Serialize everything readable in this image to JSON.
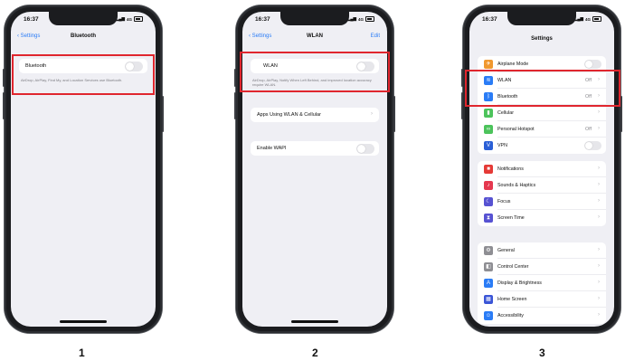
{
  "status": {
    "time": "16:37",
    "signal": "4G"
  },
  "phone1": {
    "back": "Settings",
    "title": "Bluetooth",
    "row_label": "Bluetooth",
    "note": "AirDrop, AirPlay, Find My, and Location Services use Bluetooth.",
    "number": "1"
  },
  "phone2": {
    "back": "Settings",
    "title": "WLAN",
    "edit": "Edit",
    "wlan_label": "WLAN",
    "note": "AirDrop, AirPlay, Notify When Left Behind, and improved location accuracy require WLAN.",
    "apps_label": "Apps Using WLAN & Cellular",
    "wapi_label": "Enable WAPI",
    "number": "2"
  },
  "phone3": {
    "title": "Settings",
    "number": "3",
    "group1": [
      {
        "label": "Airplane Mode",
        "icon": "airplane-icon",
        "color": "#f0982f",
        "type": "toggle"
      },
      {
        "label": "WLAN",
        "icon": "wifi-icon",
        "color": "#2a7cf6",
        "value": "Off"
      },
      {
        "label": "Bluetooth",
        "icon": "bluetooth-icon",
        "color": "#2a7cf6",
        "value": "Off"
      },
      {
        "label": "Cellular",
        "icon": "cellular-icon",
        "color": "#4cc35b"
      },
      {
        "label": "Personal Hotspot",
        "icon": "hotspot-icon",
        "color": "#4cc35b",
        "value": "Off"
      },
      {
        "label": "VPN",
        "icon": "vpn-icon",
        "color": "#2a5fd6",
        "type": "toggle"
      }
    ],
    "group2": [
      {
        "label": "Notifications",
        "icon": "notifications-icon",
        "color": "#e53a36"
      },
      {
        "label": "Sounds & Haptics",
        "icon": "sounds-icon",
        "color": "#e5384f"
      },
      {
        "label": "Focus",
        "icon": "focus-icon",
        "color": "#5752d2"
      },
      {
        "label": "Screen Time",
        "icon": "screen-time-icon",
        "color": "#5752d2"
      }
    ],
    "group3": [
      {
        "label": "General",
        "icon": "gear-icon",
        "color": "#8e8e93"
      },
      {
        "label": "Control Center",
        "icon": "control-center-icon",
        "color": "#8e8e93"
      },
      {
        "label": "Display & Brightness",
        "icon": "display-icon",
        "color": "#2a7cf6"
      },
      {
        "label": "Home Screen",
        "icon": "home-screen-icon",
        "color": "#3a55d6"
      },
      {
        "label": "Accessibility",
        "icon": "accessibility-icon",
        "color": "#2a7cf6"
      }
    ]
  }
}
